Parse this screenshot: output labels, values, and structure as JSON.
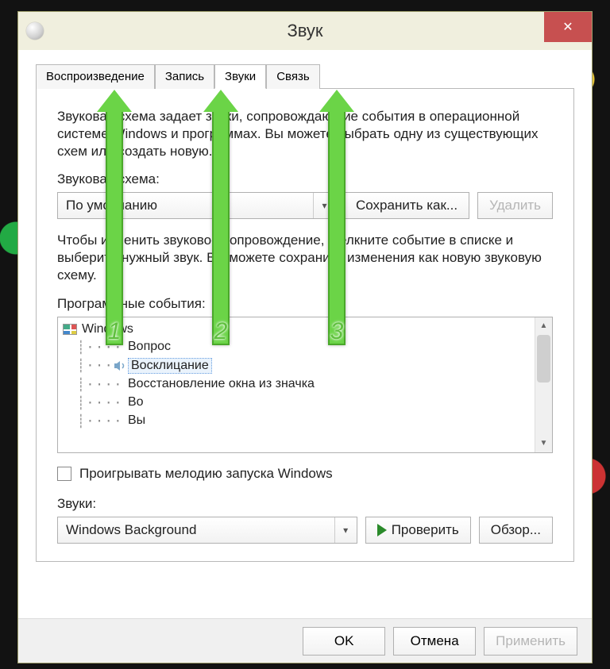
{
  "window": {
    "title": "Звук"
  },
  "tabs": [
    {
      "label": "Воспроизведение"
    },
    {
      "label": "Запись"
    },
    {
      "label": "Звуки"
    },
    {
      "label": "Связь"
    }
  ],
  "active_tab": 2,
  "panel": {
    "description": "Звуковая схема задает звуки, сопровождающие события в операционной системе Windows и программах. Вы можете выбрать одну из существующих схем или создать новую.",
    "scheme_label": "Звуковая схема:",
    "scheme_value": "По умолчанию",
    "save_as": "Сохранить как...",
    "delete": "Удалить",
    "instruction": "Чтобы изменить звуковое сопровождение, щелкните событие в списке и выберите нужный звук. Вы можете сохранить изменения как новую звуковую схему.",
    "events_label": "Программные события:",
    "tree": {
      "root": "Windows",
      "items": [
        {
          "label": "Вопрос",
          "has_sound": false
        },
        {
          "label": "Восклицание",
          "has_sound": true,
          "selected": true
        },
        {
          "label": "Восстановление окна из значка",
          "has_sound": false
        },
        {
          "label": "Во",
          "has_sound": false
        },
        {
          "label": "Вы",
          "has_sound": false
        }
      ]
    },
    "play_startup": "Проигрывать мелодию запуска Windows",
    "sounds_label": "Звуки:",
    "sound_value": "Windows Background",
    "test": "Проверить",
    "browse": "Обзор..."
  },
  "footer": {
    "ok": "OK",
    "cancel": "Отмена",
    "apply": "Применить"
  },
  "annotations": [
    {
      "n": "1"
    },
    {
      "n": "2"
    },
    {
      "n": "3"
    }
  ]
}
